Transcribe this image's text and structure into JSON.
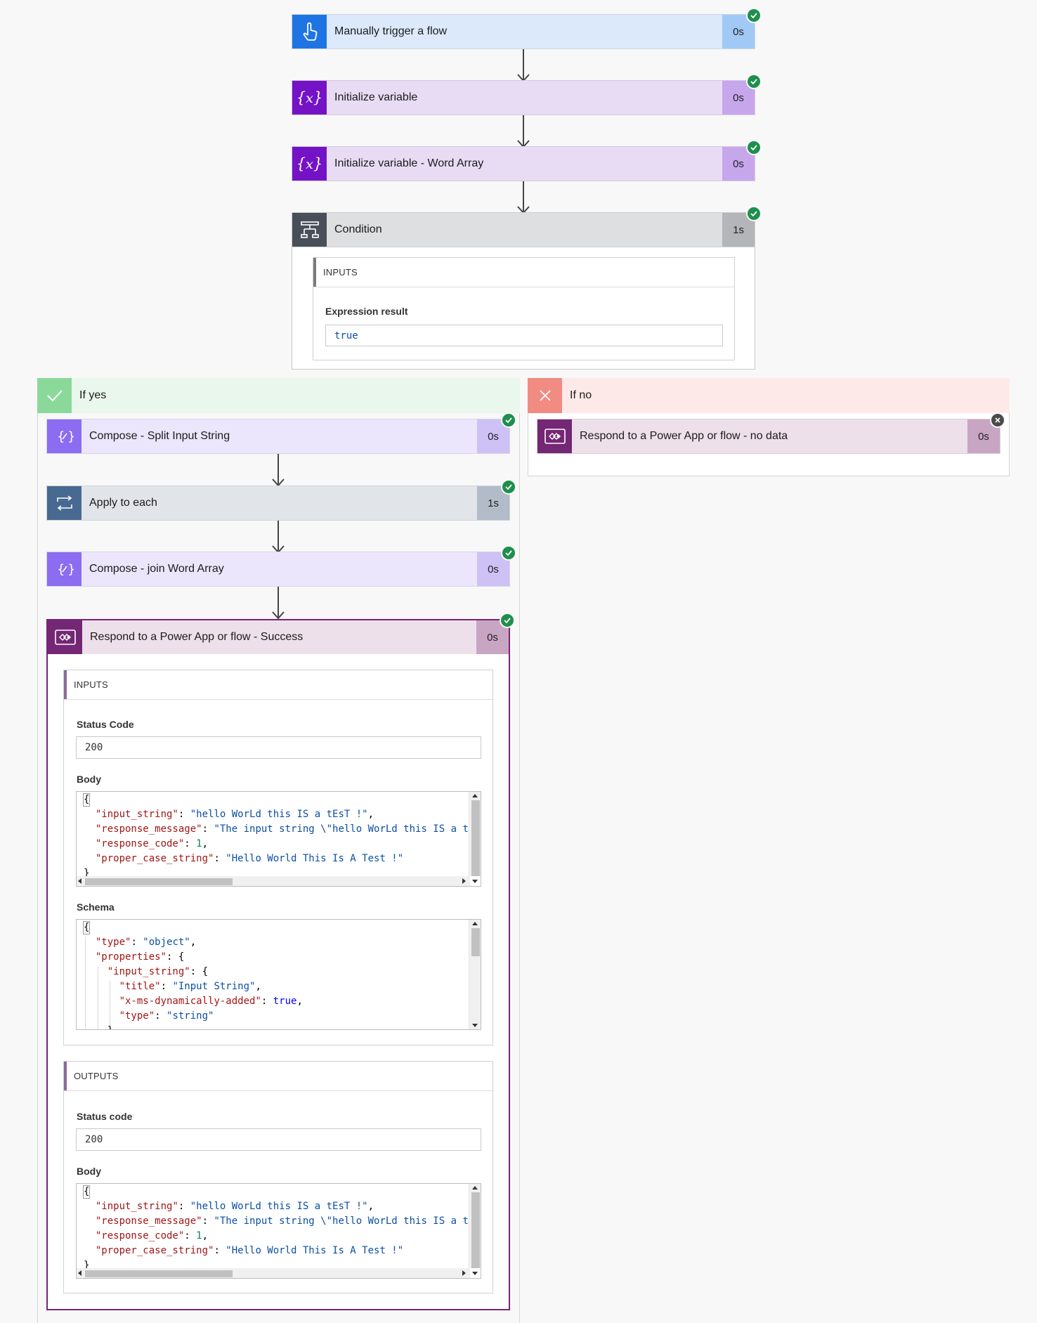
{
  "flow": {
    "trigger": {
      "title": "Manually trigger a flow",
      "duration": "0s"
    },
    "init_var": {
      "title": "Initialize variable",
      "duration": "0s"
    },
    "init_var_word": {
      "title": "Initialize variable - Word Array",
      "duration": "0s"
    },
    "condition": {
      "title": "Condition",
      "duration": "1s",
      "inputs_header": "INPUTS",
      "expression_label": "Expression result",
      "expression_value": "true"
    }
  },
  "branch_yes": {
    "label": "If yes",
    "compose_split": {
      "title": "Compose - Split Input String",
      "duration": "0s"
    },
    "apply_each": {
      "title": "Apply to each",
      "duration": "1s"
    },
    "compose_join": {
      "title": "Compose - join Word Array",
      "duration": "0s"
    },
    "respond_success": {
      "title": "Respond to a Power App or flow - Success",
      "duration": "0s",
      "inputs": {
        "header": "INPUTS",
        "status_label": "Status Code",
        "status_value": "200",
        "body_label": "Body",
        "schema_label": "Schema"
      },
      "outputs": {
        "header": "OUTPUTS",
        "status_label": "Status code",
        "status_value": "200",
        "body_label": "Body"
      }
    }
  },
  "branch_no": {
    "label": "If no",
    "respond_no_data": {
      "title": "Respond to a Power App or flow - no data",
      "duration": "0s"
    }
  },
  "code": {
    "body": {
      "open": "{",
      "close": "}",
      "l1_key": "\"input_string\"",
      "l1_val": "\"hello WorLd this IS a tEsT !\"",
      "l2_key": "\"response_message\"",
      "l2_val": "\"The input string \\\"hello WorLd this IS a tEs",
      "l3_key": "\"response_code\"",
      "l3_val": "1",
      "l4_key": "\"proper_case_string\"",
      "l4_val": "\"Hello World This Is A Test !\""
    },
    "schema": {
      "open": "{",
      "l1_key": "\"type\"",
      "l1_val": "\"object\"",
      "l2_key": "\"properties\"",
      "l3_key": "\"input_string\"",
      "l4_key": "\"title\"",
      "l4_val": "\"Input String\"",
      "l5_key": "\"x-ms-dynamically-added\"",
      "l5_val": "true",
      "l6_key": "\"type\"",
      "l6_val": "\"string\"",
      "l7": "}"
    }
  },
  "colors": {
    "trigger_bg": "#dbe9fa",
    "trigger_icon": "#1f74e3",
    "trigger_dur": "#a2c9f5",
    "var_bg": "#e8dcf5",
    "var_icon": "#7413c5",
    "var_dur": "#c7a7ec",
    "cond_bg": "#dedfe0",
    "cond_icon": "#484f58",
    "cond_dur": "#b3b5b8",
    "compose_bg": "#ebe6fb",
    "compose_icon": "#8c6cf0",
    "compose_dur": "#cdc1f6",
    "apply_bg": "#e1e5ea",
    "apply_icon": "#486991",
    "apply_dur": "#b2bcc8",
    "respond_bg": "#ede0ea",
    "respond_icon": "#742774",
    "respond_dur": "#c9a5c4",
    "yes_bg": "#e9f7ec",
    "yes_icon": "#8bd99a",
    "no_bg": "#fdeae8",
    "no_icon": "#f28b82"
  },
  "icons": {
    "trigger": "hand-tap-icon",
    "variable": "variable-x-icon",
    "condition": "condition-icon",
    "compose": "compose-icon",
    "loop": "loop-icon",
    "powerapps": "powerapps-icon",
    "check": "check-icon",
    "close": "close-icon"
  }
}
